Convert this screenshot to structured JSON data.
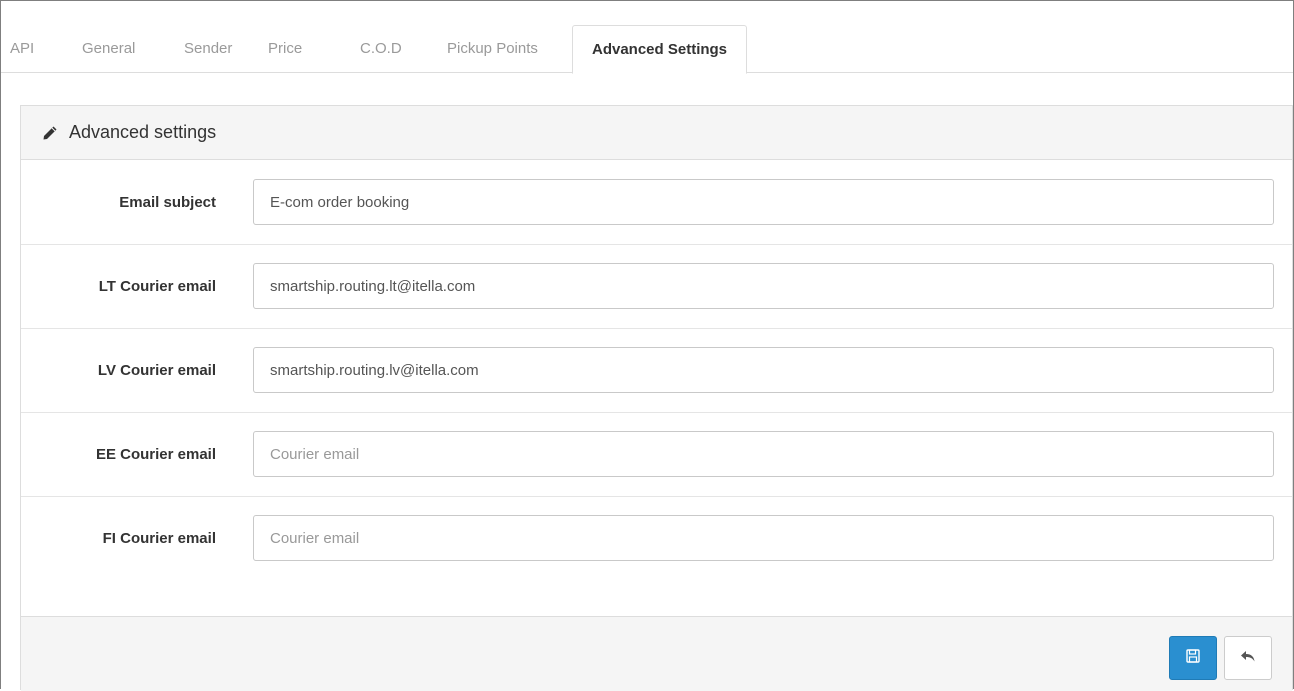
{
  "tabs": [
    {
      "label": "API",
      "active": false
    },
    {
      "label": "General",
      "active": false
    },
    {
      "label": "Sender",
      "active": false
    },
    {
      "label": "Price",
      "active": false
    },
    {
      "label": "C.O.D",
      "active": false
    },
    {
      "label": "Pickup Points",
      "active": false
    },
    {
      "label": "Advanced Settings",
      "active": true
    }
  ],
  "panel": {
    "heading": "Advanced settings",
    "heading_icon": "pencil-icon"
  },
  "fields": [
    {
      "label": "Email subject",
      "value": "E-com order booking",
      "placeholder": ""
    },
    {
      "label": "LT Courier email",
      "value": "smartship.routing.lt@itella.com",
      "placeholder": ""
    },
    {
      "label": "LV Courier email",
      "value": "smartship.routing.lv@itella.com",
      "placeholder": ""
    },
    {
      "label": "EE Courier email",
      "value": "",
      "placeholder": "Courier email"
    },
    {
      "label": "FI Courier email",
      "value": "",
      "placeholder": "Courier email"
    }
  ],
  "footer": {
    "save_icon": "floppy-disk-icon",
    "cancel_icon": "reply-arrow-icon"
  },
  "colors": {
    "primary_button": "#2a8fd0",
    "panel_background": "#f5f5f5",
    "border": "#dddddd"
  }
}
